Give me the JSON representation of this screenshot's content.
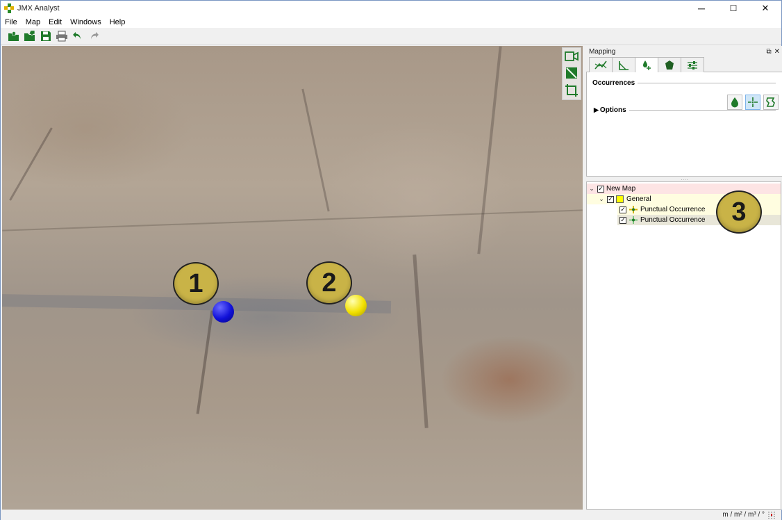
{
  "window": {
    "title": "JMX Analyst",
    "minimize": "─",
    "maximize": "☐",
    "close": "✕"
  },
  "menu": [
    "File",
    "Map",
    "Edit",
    "Windows",
    "Help"
  ],
  "viewport": {
    "callouts": [
      "1",
      "2",
      "3"
    ],
    "marker_colors": {
      "marker1": "#1010d8",
      "marker2": "#f2e000"
    }
  },
  "panel": {
    "title": "Mapping",
    "section_occurrences": "Occurrences",
    "section_options": "Options",
    "tree": {
      "root": "New Map",
      "group": "General",
      "group_color": "#ffff00",
      "items": [
        "Punctual Occurrence",
        "Punctual Occurrence"
      ]
    }
  },
  "statusbar": {
    "units": "m / m² / m³ / °"
  },
  "colors": {
    "accent_green": "#1f7a2a",
    "root_highlight": "#fde4e4",
    "group_highlight": "#fffde0",
    "selected_row": "#e8e6d8"
  }
}
